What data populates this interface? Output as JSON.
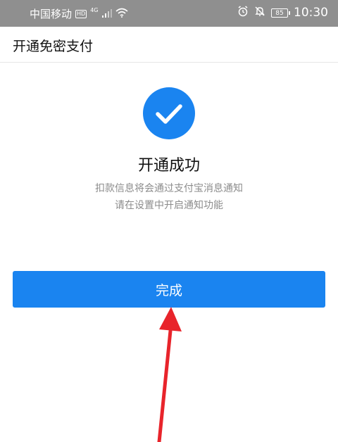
{
  "status_bar": {
    "carrier": "中国移动",
    "hd": "HD",
    "network": "4G",
    "battery": "85",
    "time": "10:30",
    "icons": [
      "signal-icon",
      "wifi-icon",
      "alarm-icon",
      "mute-icon",
      "battery-icon"
    ]
  },
  "header": {
    "title": "开通免密支付"
  },
  "result": {
    "icon": "check-icon",
    "title": "开通成功",
    "desc_line1": "扣款信息将会通过支付宝消息通知",
    "desc_line2": "请在设置中开启通知功能"
  },
  "actions": {
    "done_label": "完成"
  },
  "colors": {
    "accent": "#1a84f0",
    "annotation_arrow": "#e8242b"
  }
}
